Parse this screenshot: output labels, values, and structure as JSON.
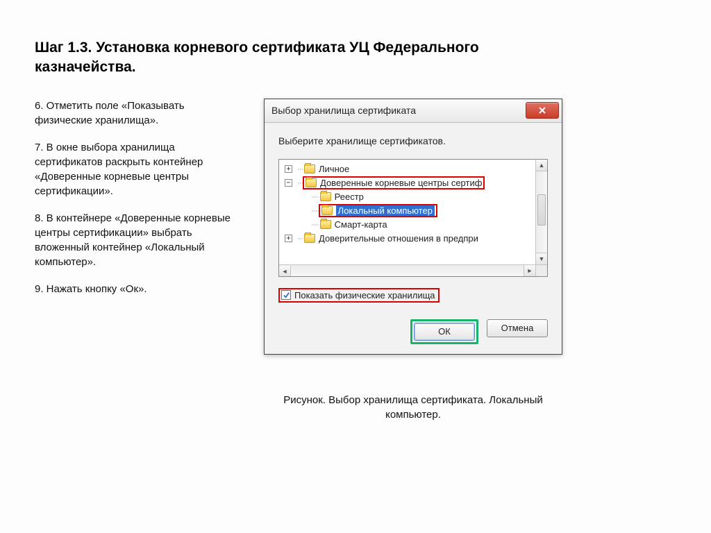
{
  "page": {
    "title": "Шаг 1.3. Установка корневого сертификата УЦ Федерального казначейства."
  },
  "steps": {
    "s6": "6. Отметить поле «Показывать физические хранилища».",
    "s7": "7. В окне выбора хранилища сертификатов раскрыть контейнер «Доверенные корневые центры сертификации».",
    "s8": "8. В контейнере «Доверенные корневые центры сертификации» выбрать вложенный контейнер «Локальный компьютер».",
    "s9": "9. Нажать кнопку «Ок»."
  },
  "dialog": {
    "title": "Выбор хранилища сертификата",
    "prompt": "Выберите хранилище сертификатов.",
    "tree": {
      "personal": "Личное",
      "trusted": "Доверенные корневые центры сертиф",
      "registry": "Реестр",
      "local_pc": "Локальный компьютер",
      "smartcard": "Смарт-карта",
      "enterprise": "Доверительные отношения в предпри"
    },
    "checkbox_label": "Показать физические хранилища",
    "buttons": {
      "ok": "ОК",
      "cancel": "Отмена"
    }
  },
  "caption": "Рисунок. Выбор хранилища сертификата. Локальный компьютер."
}
